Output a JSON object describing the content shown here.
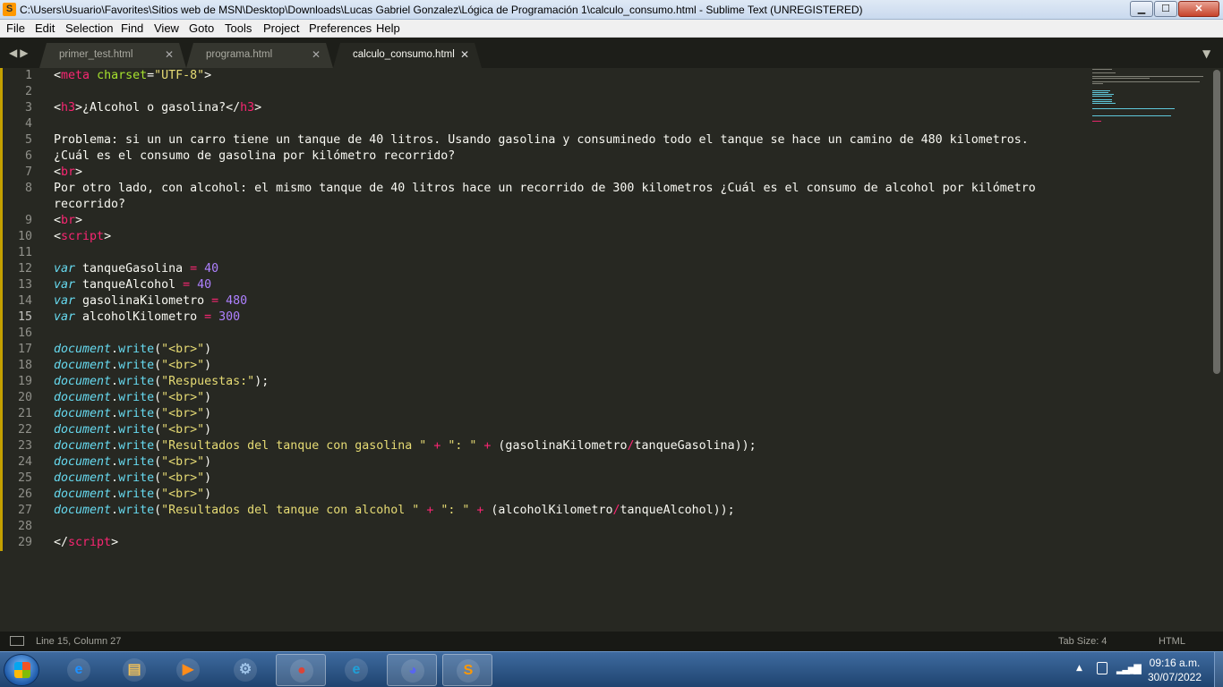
{
  "window": {
    "title": "C:\\Users\\Usuario\\Favorites\\Sitios web de MSN\\Desktop\\Downloads\\Lucas Gabriel Gonzalez\\Lógica de Programación 1\\calculo_consumo.html - Sublime Text (UNREGISTERED)",
    "icon_letter": "S",
    "controls": {
      "minimize": "▁",
      "maximize": "☐",
      "close": "✕"
    }
  },
  "menu": [
    "File",
    "Edit",
    "Selection",
    "Find",
    "View",
    "Goto",
    "Tools",
    "Project",
    "Preferences",
    "Help"
  ],
  "tabs": [
    {
      "label": "primer_test.html",
      "active": false,
      "close": "✕"
    },
    {
      "label": "programa.html",
      "active": false,
      "close": "✕"
    },
    {
      "label": "calculo_consumo.html",
      "active": true,
      "close": "✕"
    }
  ],
  "editor": {
    "current_line": 15,
    "lines": [
      {
        "n": "1",
        "parts": [
          [
            "tag-plain",
            "<"
          ],
          [
            "tag",
            "meta"
          ],
          [
            "plain",
            " "
          ],
          [
            "attr",
            "charset"
          ],
          [
            "plain",
            "="
          ],
          [
            "str",
            "\"UTF-8\""
          ],
          [
            "plain",
            ">"
          ]
        ]
      },
      {
        "n": "2",
        "parts": []
      },
      {
        "n": "3",
        "parts": [
          [
            "plain",
            "<"
          ],
          [
            "tag",
            "h3"
          ],
          [
            "plain",
            ">¿Alcohol o gasolina?</"
          ],
          [
            "tag",
            "h3"
          ],
          [
            "plain",
            ">"
          ]
        ]
      },
      {
        "n": "4",
        "parts": []
      },
      {
        "n": "5",
        "parts": [
          [
            "plain",
            "Problema: si un un carro tiene un tanque de 40 litros. Usando gasolina y consuminedo todo el tanque se hace un camino de 480 kilometros."
          ]
        ]
      },
      {
        "n": "6",
        "parts": [
          [
            "plain",
            "¿Cuál es el consumo de gasolina por kilómetro recorrido?"
          ]
        ]
      },
      {
        "n": "7",
        "parts": [
          [
            "plain",
            "<"
          ],
          [
            "tag",
            "br"
          ],
          [
            "plain",
            ">"
          ]
        ]
      },
      {
        "n": "8",
        "parts": [
          [
            "plain",
            "Por otro lado, con alcohol: el mismo tanque de 40 litros hace un recorrido de 300 kilometros ¿Cuál es el consumo de alcohol por kilómetro"
          ]
        ]
      },
      {
        "n": "",
        "parts": [
          [
            "plain",
            "recorrido?"
          ]
        ]
      },
      {
        "n": "9",
        "parts": [
          [
            "plain",
            "<"
          ],
          [
            "tag",
            "br"
          ],
          [
            "plain",
            ">"
          ]
        ]
      },
      {
        "n": "10",
        "parts": [
          [
            "plain",
            "<"
          ],
          [
            "tag",
            "script"
          ],
          [
            "plain",
            ">"
          ]
        ]
      },
      {
        "n": "11",
        "parts": []
      },
      {
        "n": "12",
        "parts": [
          [
            "kw",
            "var"
          ],
          [
            "plain",
            " tanqueGasolina "
          ],
          [
            "op",
            "="
          ],
          [
            "plain",
            " "
          ],
          [
            "num",
            "40"
          ]
        ]
      },
      {
        "n": "13",
        "parts": [
          [
            "kw",
            "var"
          ],
          [
            "plain",
            " tanqueAlcohol "
          ],
          [
            "op",
            "="
          ],
          [
            "plain",
            " "
          ],
          [
            "num",
            "40"
          ]
        ]
      },
      {
        "n": "14",
        "parts": [
          [
            "kw",
            "var"
          ],
          [
            "plain",
            " gasolinaKilometro "
          ],
          [
            "op",
            "="
          ],
          [
            "plain",
            " "
          ],
          [
            "num",
            "480"
          ]
        ]
      },
      {
        "n": "15",
        "parts": [
          [
            "kw",
            "var"
          ],
          [
            "plain",
            " alcoholKilometro "
          ],
          [
            "op",
            "="
          ],
          [
            "plain",
            " "
          ],
          [
            "num",
            "300"
          ]
        ]
      },
      {
        "n": "16",
        "parts": []
      },
      {
        "n": "17",
        "parts": [
          [
            "kw",
            "document"
          ],
          [
            "plain",
            "."
          ],
          [
            "fn",
            "write"
          ],
          [
            "plain",
            "("
          ],
          [
            "str",
            "\"<br>\""
          ],
          [
            "plain",
            ")"
          ]
        ]
      },
      {
        "n": "18",
        "parts": [
          [
            "kw",
            "document"
          ],
          [
            "plain",
            "."
          ],
          [
            "fn",
            "write"
          ],
          [
            "plain",
            "("
          ],
          [
            "str",
            "\"<br>\""
          ],
          [
            "plain",
            ")"
          ]
        ]
      },
      {
        "n": "19",
        "parts": [
          [
            "kw",
            "document"
          ],
          [
            "plain",
            "."
          ],
          [
            "fn",
            "write"
          ],
          [
            "plain",
            "("
          ],
          [
            "str",
            "\"Respuestas:\""
          ],
          [
            "plain",
            ");"
          ]
        ]
      },
      {
        "n": "20",
        "parts": [
          [
            "kw",
            "document"
          ],
          [
            "plain",
            "."
          ],
          [
            "fn",
            "write"
          ],
          [
            "plain",
            "("
          ],
          [
            "str",
            "\"<br>\""
          ],
          [
            "plain",
            ")"
          ]
        ]
      },
      {
        "n": "21",
        "parts": [
          [
            "kw",
            "document"
          ],
          [
            "plain",
            "."
          ],
          [
            "fn",
            "write"
          ],
          [
            "plain",
            "("
          ],
          [
            "str",
            "\"<br>\""
          ],
          [
            "plain",
            ")"
          ]
        ]
      },
      {
        "n": "22",
        "parts": [
          [
            "kw",
            "document"
          ],
          [
            "plain",
            "."
          ],
          [
            "fn",
            "write"
          ],
          [
            "plain",
            "("
          ],
          [
            "str",
            "\"<br>\""
          ],
          [
            "plain",
            ")"
          ]
        ]
      },
      {
        "n": "23",
        "parts": [
          [
            "kw",
            "document"
          ],
          [
            "plain",
            "."
          ],
          [
            "fn",
            "write"
          ],
          [
            "plain",
            "("
          ],
          [
            "str",
            "\"Resultados del tanque con gasolina \""
          ],
          [
            "plain",
            " "
          ],
          [
            "op",
            "+"
          ],
          [
            "plain",
            " "
          ],
          [
            "str",
            "\": \""
          ],
          [
            "plain",
            " "
          ],
          [
            "op",
            "+"
          ],
          [
            "plain",
            " (gasolinaKilometro"
          ],
          [
            "op",
            "/"
          ],
          [
            "plain",
            "tanqueGasolina));"
          ]
        ]
      },
      {
        "n": "24",
        "parts": [
          [
            "kw",
            "document"
          ],
          [
            "plain",
            "."
          ],
          [
            "fn",
            "write"
          ],
          [
            "plain",
            "("
          ],
          [
            "str",
            "\"<br>\""
          ],
          [
            "plain",
            ")"
          ]
        ]
      },
      {
        "n": "25",
        "parts": [
          [
            "kw",
            "document"
          ],
          [
            "plain",
            "."
          ],
          [
            "fn",
            "write"
          ],
          [
            "plain",
            "("
          ],
          [
            "str",
            "\"<br>\""
          ],
          [
            "plain",
            ")"
          ]
        ]
      },
      {
        "n": "26",
        "parts": [
          [
            "kw",
            "document"
          ],
          [
            "plain",
            "."
          ],
          [
            "fn",
            "write"
          ],
          [
            "plain",
            "("
          ],
          [
            "str",
            "\"<br>\""
          ],
          [
            "plain",
            ")"
          ]
        ]
      },
      {
        "n": "27",
        "parts": [
          [
            "kw",
            "document"
          ],
          [
            "plain",
            "."
          ],
          [
            "fn",
            "write"
          ],
          [
            "plain",
            "("
          ],
          [
            "str",
            "\"Resultados del tanque con alcohol \""
          ],
          [
            "plain",
            " "
          ],
          [
            "op",
            "+"
          ],
          [
            "plain",
            " "
          ],
          [
            "str",
            "\": \""
          ],
          [
            "plain",
            " "
          ],
          [
            "op",
            "+"
          ],
          [
            "plain",
            " (alcoholKilometro"
          ],
          [
            "op",
            "/"
          ],
          [
            "plain",
            "tanqueAlcohol));"
          ]
        ]
      },
      {
        "n": "28",
        "parts": []
      },
      {
        "n": "29",
        "parts": [
          [
            "plain",
            "</"
          ],
          [
            "tag",
            "script"
          ],
          [
            "plain",
            ">"
          ]
        ]
      }
    ]
  },
  "statusbar": {
    "cursor_position": "Line 15, Column 27",
    "tab_size": "Tab Size: 4",
    "syntax": "HTML"
  },
  "taskbar": {
    "apps": [
      {
        "name": "internet-explorer",
        "glyph": "e",
        "color": "#1e90ff",
        "running": false
      },
      {
        "name": "file-explorer",
        "glyph": "▤",
        "color": "#f0c05a",
        "running": false
      },
      {
        "name": "media-player",
        "glyph": "▶",
        "color": "#ff8c1a",
        "running": false
      },
      {
        "name": "control-panel",
        "glyph": "⚙",
        "color": "#9fc3e8",
        "running": false
      },
      {
        "name": "chrome",
        "glyph": "●",
        "color": "#db4437",
        "running": true
      },
      {
        "name": "edge",
        "glyph": "e",
        "color": "#1fa0d8",
        "running": false
      },
      {
        "name": "discord",
        "glyph": "◕",
        "color": "#5865f2",
        "running": true
      },
      {
        "name": "sublime-text",
        "glyph": "S",
        "color": "#ff9800",
        "running": true
      }
    ],
    "time": "09:16 a.m.",
    "date": "30/07/2022"
  },
  "colors": {
    "editor_bg": "#272822",
    "tag": "#f92672",
    "string": "#e6db74",
    "keyword": "#66d9ef",
    "number": "#ae81ff",
    "attribute": "#a6e22e"
  }
}
